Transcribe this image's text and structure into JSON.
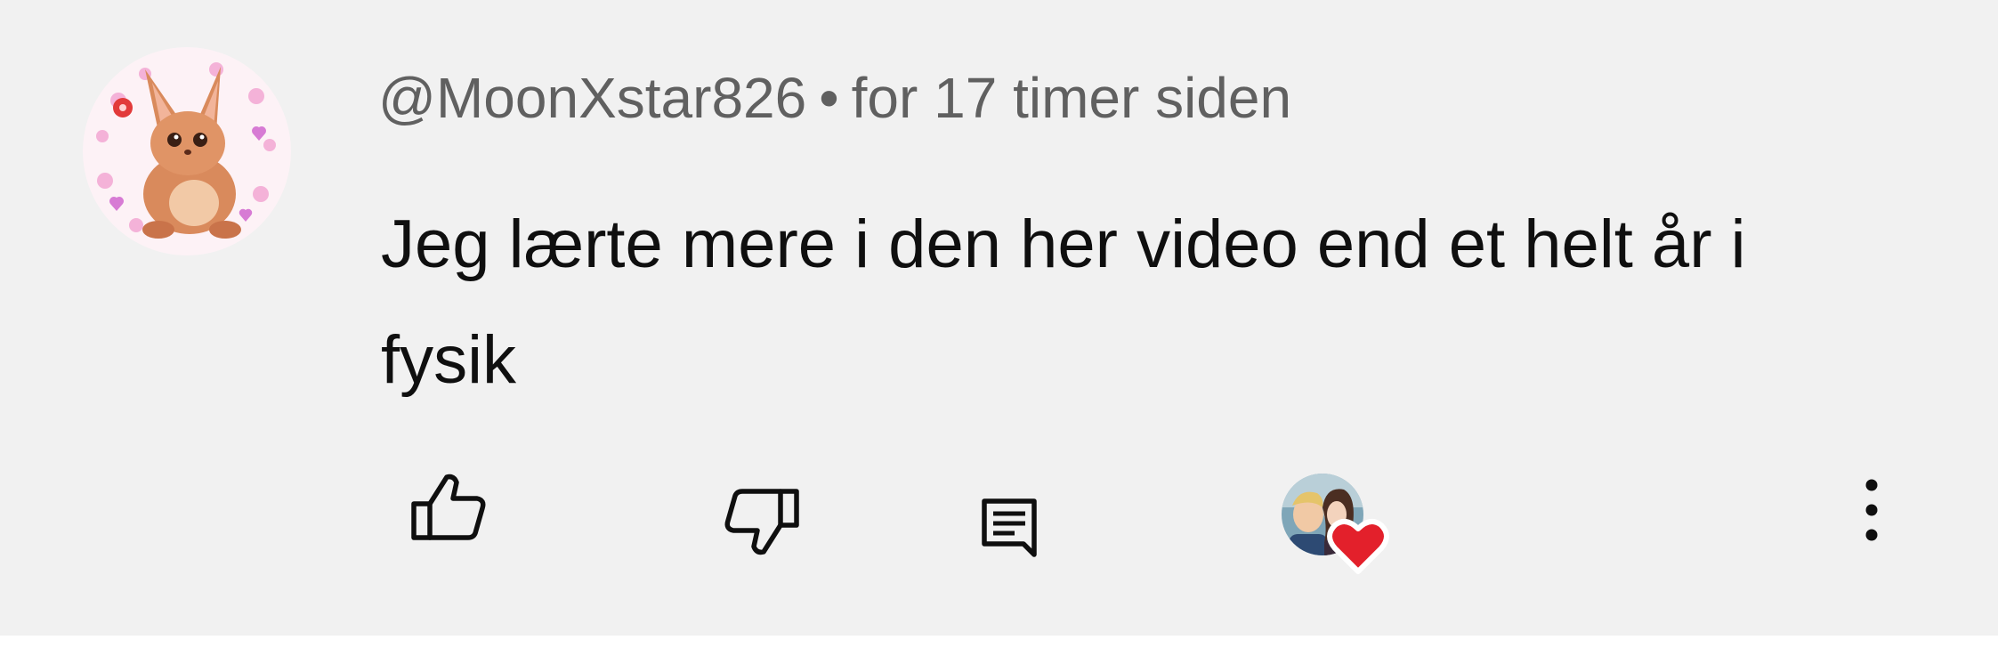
{
  "comment": {
    "author": "@MoonXstar826",
    "separator": "•",
    "timestamp": "for 17 timer siden",
    "text": "Jeg lærte mere i den her video end et helt år i fysik"
  },
  "avatar": {
    "description_icon": "cartoon-animal-avatar"
  },
  "actions": {
    "like_icon": "thumbs-up-icon",
    "dislike_icon": "thumbs-down-icon",
    "reply_icon": "comment-reply-icon",
    "creator_heart_icon": "creator-heart-icon",
    "more_icon": "more-vertical-icon"
  },
  "colors": {
    "background": "#f1f1f1",
    "meta_text": "#606060",
    "body_text": "#0f0f0f",
    "heart": "#e3202b"
  }
}
